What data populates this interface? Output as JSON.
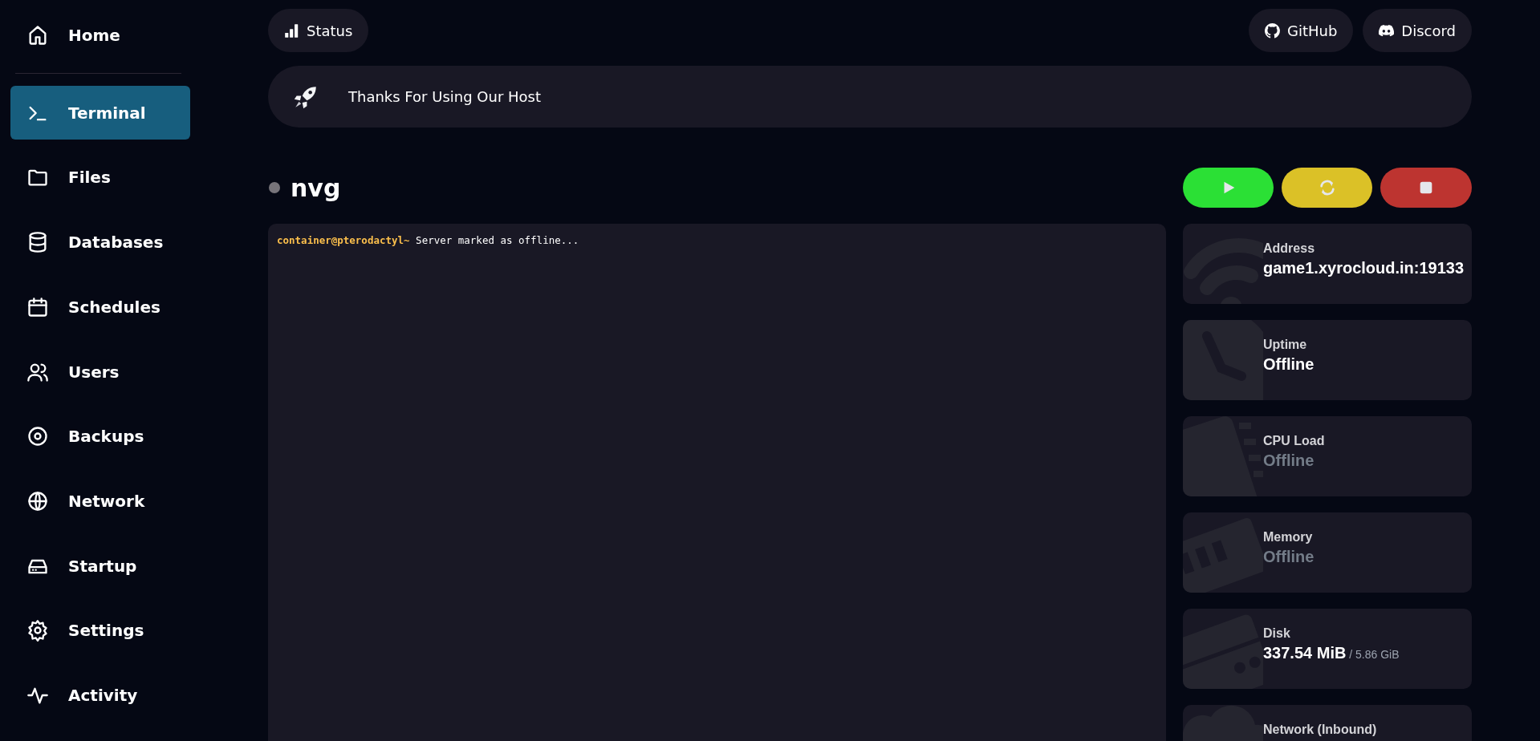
{
  "nav": {
    "sections": [
      {
        "items": [
          {
            "label": "Home",
            "kind": "home",
            "selected": false
          }
        ]
      },
      {
        "items": [
          {
            "label": "Terminal",
            "kind": "terminal",
            "selected": true
          },
          {
            "label": "Files",
            "kind": "folder",
            "selected": false
          },
          {
            "label": "Databases",
            "kind": "database",
            "selected": false
          },
          {
            "label": "Schedules",
            "kind": "calendar",
            "selected": false
          },
          {
            "label": "Users",
            "kind": "users",
            "selected": false
          },
          {
            "label": "Backups",
            "kind": "disc",
            "selected": false
          },
          {
            "label": "Network",
            "kind": "globe",
            "selected": false
          },
          {
            "label": "Startup",
            "kind": "drive",
            "selected": false
          },
          {
            "label": "Settings",
            "kind": "gear",
            "selected": false
          },
          {
            "label": "Activity",
            "kind": "pulse",
            "selected": false
          }
        ]
      }
    ]
  },
  "top_bar": {
    "left": [
      {
        "label": "Status",
        "kind": "bars"
      }
    ],
    "right": [
      {
        "label": "GitHub",
        "kind": "github"
      },
      {
        "label": "Discord",
        "kind": "discord"
      }
    ]
  },
  "banner": {
    "text": "Thanks For Using Our Host"
  },
  "server": {
    "name": "nvg",
    "online": false
  },
  "power_buttons": [
    {
      "kind": "start"
    },
    {
      "kind": "restart"
    },
    {
      "kind": "stop"
    }
  ],
  "console": {
    "lines": [
      {
        "prompt": "container@pterodactyl~",
        "text": "Server marked as offline..."
      }
    ]
  },
  "stats": [
    {
      "kind": "wifi",
      "label": "Address",
      "value": "game1.xyrocloud.in:19133",
      "muted": false
    },
    {
      "kind": "clock",
      "label": "Uptime",
      "value": "Offline",
      "muted": false
    },
    {
      "kind": "chip",
      "label": "CPU Load",
      "value": "Offline",
      "muted": true
    },
    {
      "kind": "memory",
      "label": "Memory",
      "value": "Offline",
      "muted": true
    },
    {
      "kind": "drive",
      "label": "Disk",
      "value": "337.54 MiB",
      "suffix": "/ 5.86 GiB",
      "muted": false
    },
    {
      "kind": "cloud",
      "label": "Network (Inbound)"
    }
  ]
}
